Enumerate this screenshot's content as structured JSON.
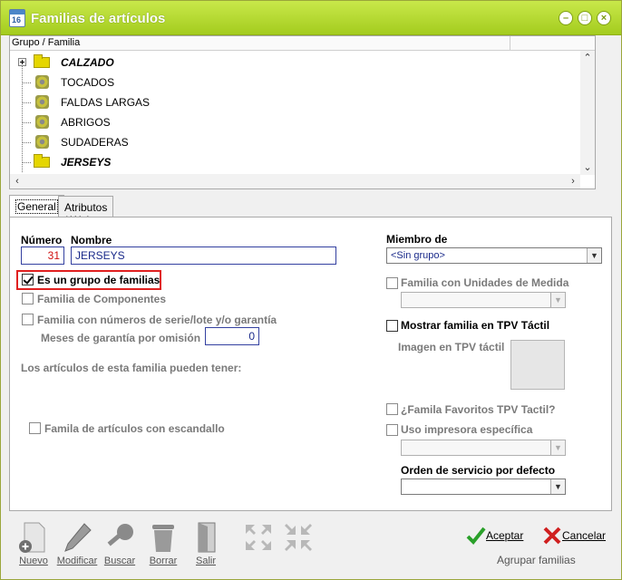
{
  "window": {
    "app_icon_number": "16",
    "title": "Familias de artículos",
    "controls": {
      "minimize": "–",
      "maximize": "□",
      "close": "×"
    }
  },
  "tree": {
    "header": "Grupo / Familia",
    "items": [
      {
        "label": "CALZADO",
        "type": "group"
      },
      {
        "label": "TOCADOS",
        "type": "family"
      },
      {
        "label": "FALDAS LARGAS",
        "type": "family"
      },
      {
        "label": "ABRIGOS",
        "type": "family"
      },
      {
        "label": "SUDADERAS",
        "type": "family"
      },
      {
        "label": "JERSEYS",
        "type": "group"
      }
    ]
  },
  "tabs": [
    {
      "label": "General",
      "active": true
    },
    {
      "label": "Atributos / Web",
      "active": false
    }
  ],
  "general": {
    "numero_label": "Número",
    "numero_value": "31",
    "nombre_label": "Nombre",
    "nombre_value": "JERSEYS",
    "es_grupo_label": "Es un grupo de familias",
    "familia_componentes_label": "Familia de Componentes",
    "familia_serie_label": "Familia con números de serie/lote y/o garantía",
    "meses_garantia_label": "Meses de garantía por omisión",
    "meses_garantia_value": "0",
    "articulos_pueden_label": "Los artículos de esta familia pueden tener:",
    "escandallo_label": "Famila de artículos con escandallo",
    "miembro_de_label": "Miembro de",
    "miembro_de_value": "<Sin grupo>",
    "unidades_medida_label": "Familia con Unidades de Medida",
    "mostrar_tpv_label": "Mostrar familia en TPV Táctil",
    "imagen_tpv_label": "Imagen en TPV táctil",
    "favoritos_tpv_label": "¿Famila Favoritos TPV Tactil?",
    "uso_impresora_label": "Uso impresora específica",
    "orden_servicio_label": "Orden de servicio por defecto"
  },
  "toolbar": {
    "nuevo": "Nuevo",
    "modificar": "Modificar",
    "buscar": "Buscar",
    "borrar": "Borrar",
    "salir": "Salir",
    "aceptar": "Aceptar",
    "cancelar": "Cancelar",
    "agrupar": "Agrupar familias"
  },
  "colors": {
    "titlebar": "#b5d92e",
    "highlight": "#e02020",
    "aceptar_icon": "#2aa02a",
    "cancelar_icon": "#d02020"
  }
}
